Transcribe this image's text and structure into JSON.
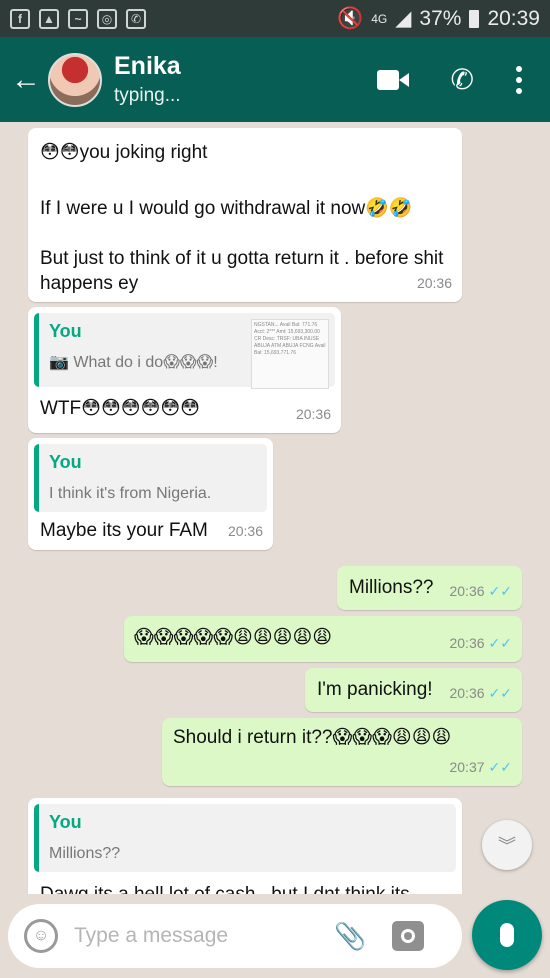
{
  "status_bar": {
    "network": "4G",
    "battery": "37%",
    "time": "20:39"
  },
  "header": {
    "contact_name": "Enika",
    "contact_status": "typing..."
  },
  "messages": [
    {
      "direction": "in",
      "lines": [
        "😳😳you joking right",
        "If I were u I would go withdrawal it now🤣🤣",
        "But just to think of it u gotta return it . before shit happens ey"
      ],
      "time": "20:36"
    },
    {
      "direction": "in",
      "quote": {
        "name": "You",
        "text": "📷 What do i do😱😱😱!",
        "thumb": "NGSTAN... Avail Bal: 771.76 Acct: 2*** Amt: 15,693,300.00 CR Desc: TRSF: UBA INUSE ABUJA ATM ABUJA FCNG Avail Bal: 15,693,771.76"
      },
      "text": "WTF😳😳😳😳😳😳",
      "time": "20:36"
    },
    {
      "direction": "in",
      "quote": {
        "name": "You",
        "text": "I think it's from Nigeria."
      },
      "text": "Maybe its your FAM",
      "time": "20:36"
    },
    {
      "direction": "out",
      "text": "Millions??",
      "time": "20:36"
    },
    {
      "direction": "out",
      "text": "😱😱😱😱😱😩😩😩😩😩",
      "time": "20:36"
    },
    {
      "direction": "out",
      "text": "I'm panicking!",
      "time": "20:36"
    },
    {
      "direction": "out",
      "text": "Should i return it??😱😱😱😩😩😩",
      "time": "20:37"
    },
    {
      "direction": "in",
      "quote": {
        "name": "You",
        "text": "Millions??"
      },
      "text": "Dawg its a hell lot of cash.. but I dnt think its"
    }
  ],
  "input": {
    "placeholder": "Type a message"
  },
  "icons": {
    "back": "arrow-left-icon",
    "video": "video-call-icon",
    "call": "phone-icon",
    "menu": "more-vert-icon",
    "emoji": "emoji-icon",
    "attach": "paperclip-icon",
    "camera": "camera-icon",
    "mic": "microphone-icon",
    "scroll": "chevron-double-down-icon"
  },
  "colors": {
    "header": "#075e54",
    "outgoing_bubble": "#dcf8c6",
    "incoming_bubble": "#ffffff",
    "accent": "#06a884",
    "read_ticks": "#4fc3f7",
    "mic_button": "#00897b"
  }
}
